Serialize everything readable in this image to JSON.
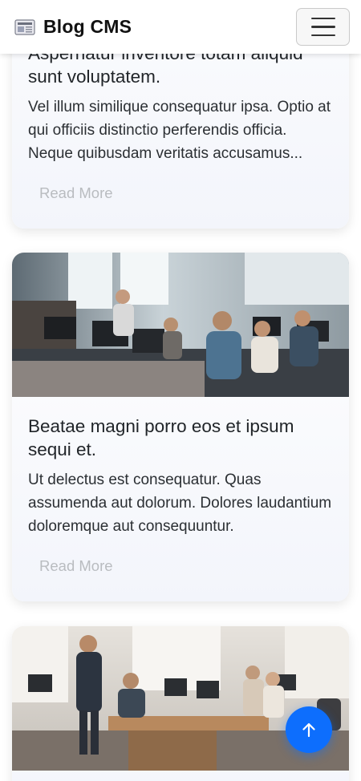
{
  "navbar": {
    "brand": "Blog CMS",
    "brand_icon": "newspaper-icon",
    "menu_icon": "hamburger-menu-icon"
  },
  "posts": [
    {
      "title": "Aspernatur inventore totam aliquid sunt voluptatem.",
      "excerpt": "Vel illum similique consequatur ipsa. Optio at qui officiis distinctio perferendis officia. Neque quibusdam veritatis accusamus...",
      "read_more": "Read More"
    },
    {
      "title": "Beatae magni porro eos et ipsum sequi et.",
      "excerpt": "Ut delectus est consequatur. Quas assumenda aut dolorum. Dolores laudantium doloremque aut consequuntur.",
      "read_more": "Read More",
      "image": "office-team-photo"
    },
    {
      "image": "meeting-room-photo"
    }
  ],
  "scroll_top_button": {
    "icon": "arrow-up-icon"
  },
  "colors": {
    "accent": "#0d6efd",
    "read_more": "#b9bcc0",
    "title": "#212529"
  }
}
